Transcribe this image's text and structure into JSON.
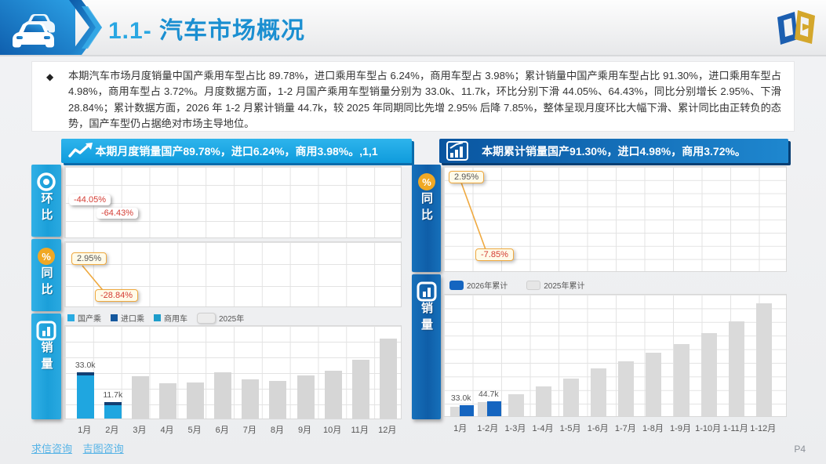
{
  "header": {
    "title_prefix": "1.1-",
    "title_text": "汽车市场概况"
  },
  "summary": {
    "bullet": "◆",
    "text": "本期汽车市场月度销量中国产乘用车型占比 89.78%，进口乘用车型占 6.24%，商用车型占 3.98%；累计销量中国产乘用车型占比 91.30%，进口乘用车型占 4.98%，商用车型占 3.72%。月度数据方面，1-2 月国产乘用车型销量分别为 33.0k、11.7k，环比分别下滑 44.05%、64.43%，同比分别增长 2.95%、下滑 28.84%；累计数据方面，2026 年 1-2 月累计销量 44.7k，较 2025 年同期同比先增 2.95% 后降 7.85%，整体呈现月度环比大幅下滑、累计同比由正转负的态势，国产车型仍占据绝对市场主导地位。"
  },
  "left_section": {
    "banner": "本期月度销量国产89.78%，进口6.24%，商用3.98%。,1,1",
    "tabs": [
      {
        "label": "环比",
        "icon": "target-icon"
      },
      {
        "label": "同比",
        "icon": "percent-icon"
      },
      {
        "label": "销量",
        "icon": "bar-chart-icon"
      }
    ],
    "annotations": {
      "mom_jan": "-44.05%",
      "mom_feb": "-64.43%",
      "yoy_jan": "2.95%",
      "yoy_feb": "-28.84%"
    },
    "legend": [
      {
        "label": "国产乘",
        "color": "#29abe2"
      },
      {
        "label": "进口乘",
        "color": "#15589e"
      },
      {
        "label": "商用车",
        "color": "#1d9dcb"
      },
      {
        "label": "2025年",
        "color": "#ececec"
      }
    ]
  },
  "right_section": {
    "banner": "本期累计销量国产91.30%，进口4.98%，商用3.72%。",
    "tabs": [
      {
        "label": "同比",
        "icon": "percent-icon"
      },
      {
        "label": "销量",
        "icon": "bar-chart-icon"
      }
    ],
    "annotations": {
      "yoy_first": "2.95%",
      "yoy_last": "-7.85%"
    },
    "legend": [
      {
        "label": "2026年累计",
        "color": "#1565c0"
      },
      {
        "label": "2025年累计",
        "color": "#e6e6e6"
      }
    ]
  },
  "footer": {
    "link1": "求信咨询",
    "link2": "吉图咨询",
    "page": "P4"
  },
  "palette": {
    "accent_cyan": "#1fa6e0",
    "accent_blue": "#1565c0",
    "banner_left": "#0f9bdc",
    "banner_right": "#0a55a0",
    "negative_red": "#d43c33",
    "callout_orange": "#efa93f",
    "bar_gray": "#d6d6d6",
    "title_blue": "#1b8fd1"
  },
  "chart_data": [
    {
      "id": "monthly-sales",
      "type": "bar",
      "title": "本期月度销量国产89.78%，进口6.24%，商用3.98%。,1,1",
      "categories": [
        "1月",
        "2月",
        "3月",
        "4月",
        "5月",
        "6月",
        "7月",
        "8月",
        "9月",
        "10月",
        "11月",
        "12月"
      ],
      "series": [
        {
          "name": "2026年月度销量(国产乘+进口乘+商用车)",
          "color": "#1fa6e0",
          "values": [
            33.0,
            11.7,
            null,
            null,
            null,
            null,
            null,
            null,
            null,
            null,
            null,
            null
          ]
        },
        {
          "name": "2025年",
          "color": "#d6d6d6",
          "values": [
            null,
            null,
            30,
            25,
            26,
            33,
            28,
            27,
            31,
            34,
            42,
            57
          ]
        }
      ],
      "unit": "k",
      "ylim": [
        0,
        66
      ],
      "grid": true,
      "legend_position": "top-left",
      "data_labels": {
        "0": "33.0k",
        "1": "11.7k"
      },
      "annotations": {
        "环比": [
          "-44.05%",
          "-64.43%"
        ],
        "同比": [
          "2.95%",
          "-28.84%"
        ]
      }
    },
    {
      "id": "cumulative-sales",
      "type": "bar",
      "title": "本期累计销量国产91.30%，进口4.98%，商用3.72%。",
      "categories": [
        "1月",
        "1-2月",
        "1-3月",
        "1-4月",
        "1-5月",
        "1-6月",
        "1-7月",
        "1-8月",
        "1-9月",
        "1-10月",
        "1-11月",
        "1-12月"
      ],
      "series": [
        {
          "name": "2026年累计",
          "color": "#1565c0",
          "values": [
            33.0,
            44.7,
            null,
            null,
            null,
            null,
            null,
            null,
            null,
            null,
            null,
            null
          ]
        },
        {
          "name": "2025年累计",
          "color": "#dadada",
          "values": [
            29,
            43,
            68,
            91,
            114,
            145,
            168,
            194,
            220,
            253,
            289,
            343
          ]
        }
      ],
      "unit": "k",
      "ylim": [
        0,
        370
      ],
      "grid": true,
      "legend_position": "top-left",
      "data_labels": {
        "0": "33.0k",
        "1": "44.7k"
      },
      "annotations": {
        "同比": [
          "2.95%",
          "-7.85%"
        ]
      }
    }
  ]
}
